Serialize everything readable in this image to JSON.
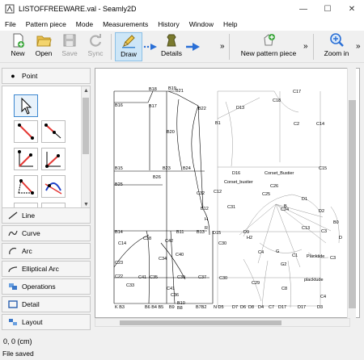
{
  "window": {
    "title": "LISTOFFREEWARE.val - Seamly2D"
  },
  "menu": [
    "File",
    "Pattern piece",
    "Mode",
    "Measurements",
    "History",
    "Window",
    "Help"
  ],
  "toolbar": {
    "new": "New",
    "open": "Open",
    "save": "Save",
    "sync": "Sync",
    "draw": "Draw",
    "details": "Details",
    "new_pattern_piece": "New pattern piece",
    "zoom_in": "Zoom in",
    "more": "»"
  },
  "panel": {
    "point": "Point",
    "line": "Line",
    "curve": "Curve",
    "arc": "Arc",
    "elliptical_arc": "Elliptical Arc",
    "operations": "Operations",
    "detail": "Detail",
    "layout": "Layout"
  },
  "status": {
    "coordinates": "0, 0 (cm)",
    "message": "File saved"
  },
  "colors": {
    "accent": "#3c87d0",
    "draw_active": "#cde6f7",
    "pattern_line": "#000000",
    "pattern_grey": "#9a9a9a"
  }
}
